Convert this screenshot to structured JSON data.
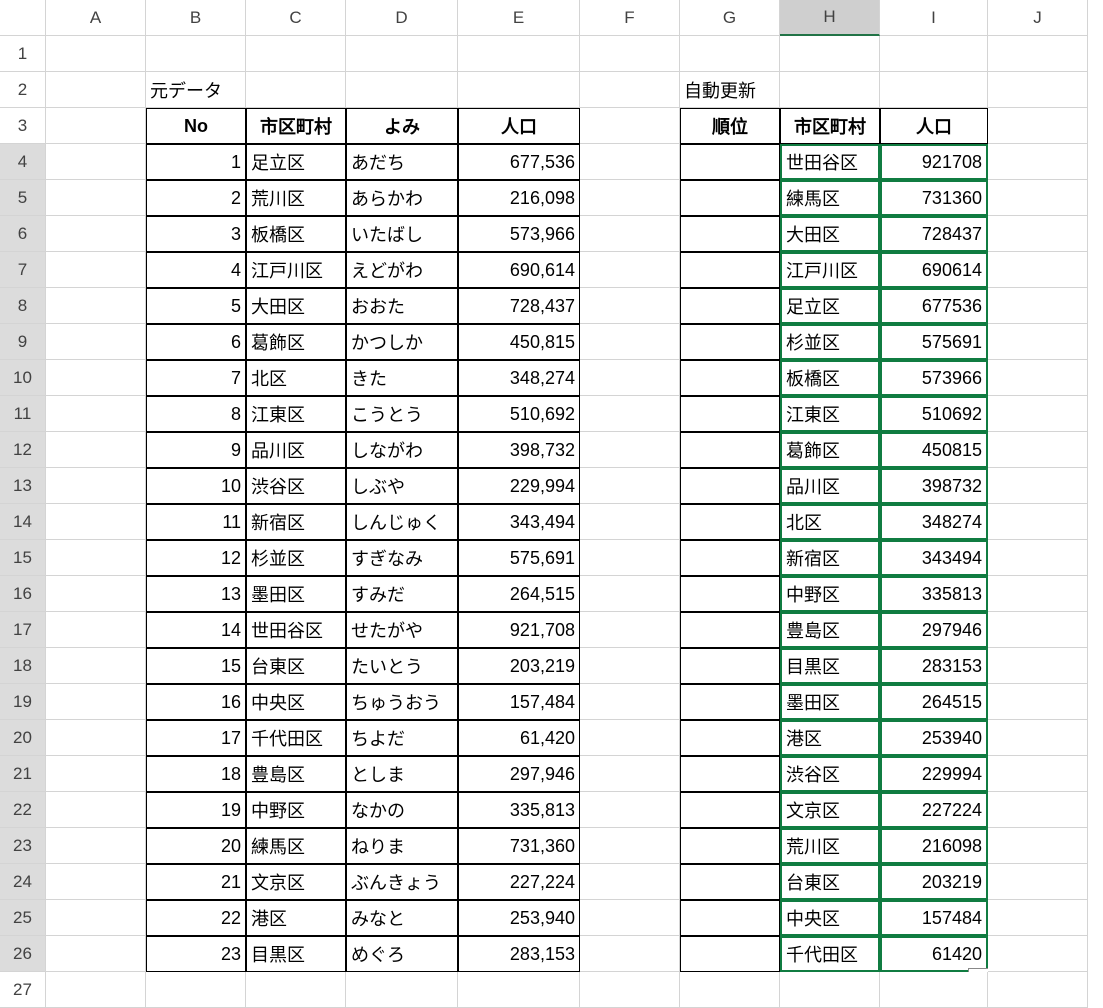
{
  "cols": [
    "A",
    "B",
    "C",
    "D",
    "E",
    "F",
    "G",
    "H",
    "I",
    "J"
  ],
  "activeCol": "H",
  "label_src": "元データ",
  "label_auto": "自動更新",
  "headers1": {
    "no": "No",
    "ward": "市区町村",
    "yomi": "よみ",
    "pop": "人口"
  },
  "headers2": {
    "rank": "順位",
    "ward": "市区町村",
    "pop": "人口"
  },
  "table1": [
    {
      "no": "1",
      "ward": "足立区",
      "yomi": "あだち",
      "pop": "677,536"
    },
    {
      "no": "2",
      "ward": "荒川区",
      "yomi": "あらかわ",
      "pop": "216,098"
    },
    {
      "no": "3",
      "ward": "板橋区",
      "yomi": "いたばし",
      "pop": "573,966"
    },
    {
      "no": "4",
      "ward": "江戸川区",
      "yomi": "えどがわ",
      "pop": "690,614"
    },
    {
      "no": "5",
      "ward": "大田区",
      "yomi": "おおた",
      "pop": "728,437"
    },
    {
      "no": "6",
      "ward": "葛飾区",
      "yomi": "かつしか",
      "pop": "450,815"
    },
    {
      "no": "7",
      "ward": "北区",
      "yomi": "きた",
      "pop": "348,274"
    },
    {
      "no": "8",
      "ward": "江東区",
      "yomi": "こうとう",
      "pop": "510,692"
    },
    {
      "no": "9",
      "ward": "品川区",
      "yomi": "しながわ",
      "pop": "398,732"
    },
    {
      "no": "10",
      "ward": "渋谷区",
      "yomi": "しぶや",
      "pop": "229,994"
    },
    {
      "no": "11",
      "ward": "新宿区",
      "yomi": "しんじゅく",
      "pop": "343,494"
    },
    {
      "no": "12",
      "ward": "杉並区",
      "yomi": "すぎなみ",
      "pop": "575,691"
    },
    {
      "no": "13",
      "ward": "墨田区",
      "yomi": "すみだ",
      "pop": "264,515"
    },
    {
      "no": "14",
      "ward": "世田谷区",
      "yomi": "せたがや",
      "pop": "921,708"
    },
    {
      "no": "15",
      "ward": "台東区",
      "yomi": "たいとう",
      "pop": "203,219"
    },
    {
      "no": "16",
      "ward": "中央区",
      "yomi": "ちゅうおう",
      "pop": "157,484"
    },
    {
      "no": "17",
      "ward": "千代田区",
      "yomi": "ちよだ",
      "pop": "61,420"
    },
    {
      "no": "18",
      "ward": "豊島区",
      "yomi": "としま",
      "pop": "297,946"
    },
    {
      "no": "19",
      "ward": "中野区",
      "yomi": "なかの",
      "pop": "335,813"
    },
    {
      "no": "20",
      "ward": "練馬区",
      "yomi": "ねりま",
      "pop": "731,360"
    },
    {
      "no": "21",
      "ward": "文京区",
      "yomi": "ぶんきょう",
      "pop": "227,224"
    },
    {
      "no": "22",
      "ward": "港区",
      "yomi": "みなと",
      "pop": "253,940"
    },
    {
      "no": "23",
      "ward": "目黒区",
      "yomi": "めぐろ",
      "pop": "283,153"
    }
  ],
  "table2": [
    {
      "ward": "世田谷区",
      "pop": "921708"
    },
    {
      "ward": "練馬区",
      "pop": "731360"
    },
    {
      "ward": "大田区",
      "pop": "728437"
    },
    {
      "ward": "江戸川区",
      "pop": "690614"
    },
    {
      "ward": "足立区",
      "pop": "677536"
    },
    {
      "ward": "杉並区",
      "pop": "575691"
    },
    {
      "ward": "板橋区",
      "pop": "573966"
    },
    {
      "ward": "江東区",
      "pop": "510692"
    },
    {
      "ward": "葛飾区",
      "pop": "450815"
    },
    {
      "ward": "品川区",
      "pop": "398732"
    },
    {
      "ward": "北区",
      "pop": "348274"
    },
    {
      "ward": "新宿区",
      "pop": "343494"
    },
    {
      "ward": "中野区",
      "pop": "335813"
    },
    {
      "ward": "豊島区",
      "pop": "297946"
    },
    {
      "ward": "目黒区",
      "pop": "283153"
    },
    {
      "ward": "墨田区",
      "pop": "264515"
    },
    {
      "ward": "港区",
      "pop": "253940"
    },
    {
      "ward": "渋谷区",
      "pop": "229994"
    },
    {
      "ward": "文京区",
      "pop": "227224"
    },
    {
      "ward": "荒川区",
      "pop": "216098"
    },
    {
      "ward": "台東区",
      "pop": "203219"
    },
    {
      "ward": "中央区",
      "pop": "157484"
    },
    {
      "ward": "千代田区",
      "pop": "61420"
    }
  ]
}
